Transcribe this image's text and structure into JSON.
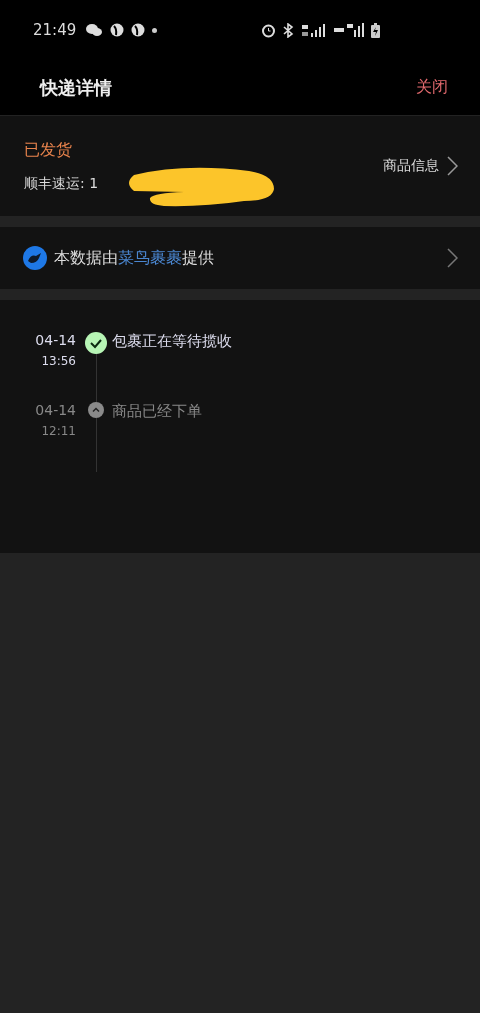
{
  "status_bar": {
    "time": "21:49"
  },
  "header": {
    "title": "快递详情",
    "close": "关闭"
  },
  "shipment": {
    "status": "已发货",
    "carrier_line": "顺丰速运: 1",
    "redacted": true,
    "goods_link": "商品信息"
  },
  "provider": {
    "prefix": "本数据由",
    "link": "菜鸟裹裹",
    "suffix": "提供"
  },
  "timeline": [
    {
      "date": "04-14",
      "time": "13:56",
      "text": "包裹正在等待揽收",
      "current": true
    },
    {
      "date": "04-14",
      "time": "12:11",
      "text": "商品已经下单",
      "current": false
    }
  ]
}
